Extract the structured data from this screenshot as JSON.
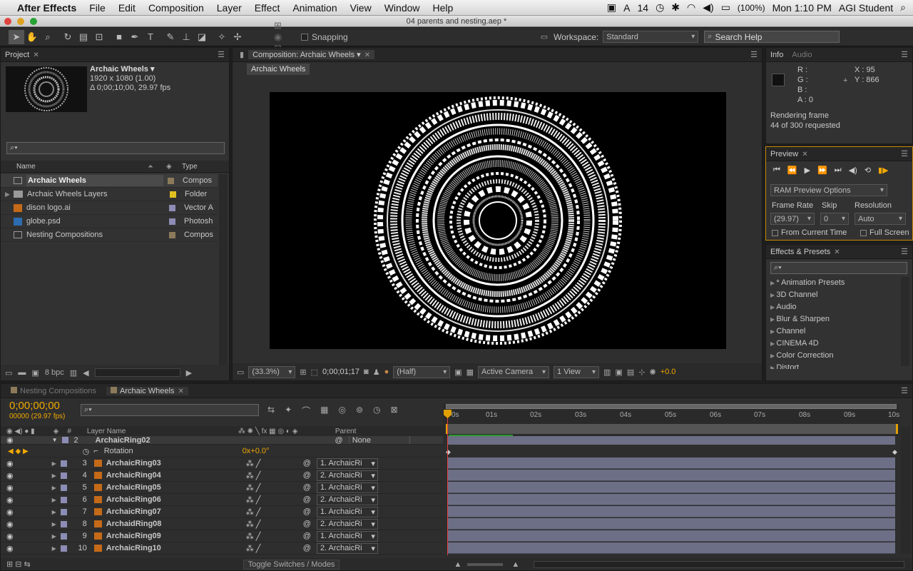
{
  "menubar": {
    "app": "After Effects",
    "items": [
      "File",
      "Edit",
      "Composition",
      "Layer",
      "Effect",
      "Animation",
      "View",
      "Window",
      "Help"
    ],
    "status_num": "14",
    "battery": "(100%)",
    "clock": "Mon 1:10 PM",
    "user": "AGI Student"
  },
  "window_title": "04 parents and nesting.aep *",
  "toolbar": {
    "snapping_label": "Snapping",
    "workspace_label": "Workspace:",
    "workspace_value": "Standard",
    "search_placeholder": "Search Help"
  },
  "project": {
    "tab": "Project",
    "selected_name": "Archaic Wheels ▾",
    "selected_size": "1920 x 1080 (1.00)",
    "selected_duration": "Δ 0;00;10;00, 29.97 fps",
    "col_name": "Name",
    "col_type": "Type",
    "items": [
      {
        "name": "Archaic Wheels",
        "type": "Compos",
        "color": "#8c7a5a",
        "icon": "composition-icon"
      },
      {
        "name": "Archaic Wheels Layers",
        "type": "Folder",
        "color": "#e0c020",
        "icon": "folder-icon"
      },
      {
        "name": "dison logo.ai",
        "type": "Vector A",
        "color": "#8c8cb4",
        "icon": "illustrator-file-icon"
      },
      {
        "name": "globe.psd",
        "type": "Photosh",
        "color": "#8c8cb4",
        "icon": "photoshop-file-icon"
      },
      {
        "name": "Nesting Compositions",
        "type": "Compos",
        "color": "#8c7a5a",
        "icon": "composition-icon"
      }
    ],
    "bpc": "8 bpc"
  },
  "composition": {
    "tab": "Composition: Archaic Wheels",
    "breadcrumb": "Archaic Wheels",
    "zoom": "(33.3%)",
    "timecode": "0;00;01;17",
    "resolution": "(Half)",
    "camera": "Active Camera",
    "view": "1 View",
    "exposure": "+0.0"
  },
  "info": {
    "tab": "Info",
    "tab2": "Audio",
    "r": "R :",
    "g": "G :",
    "b": "B :",
    "a": "A : 0",
    "x": "X : 95",
    "y": "Y : 866",
    "status1": "Rendering frame",
    "status2": "44 of 300 requested"
  },
  "preview": {
    "tab": "Preview",
    "ram_options": "RAM Preview Options",
    "frame_rate_label": "Frame Rate",
    "skip_label": "Skip",
    "resolution_label": "Resolution",
    "frame_rate": "(29.97)",
    "skip": "0",
    "resolution": "Auto",
    "from_current": "From Current Time",
    "full_screen": "Full Screen"
  },
  "effects": {
    "tab": "Effects & Presets",
    "items": [
      "* Animation Presets",
      "3D Channel",
      "Audio",
      "Blur & Sharpen",
      "Channel",
      "CINEMA 4D",
      "Color Correction",
      "Distort"
    ]
  },
  "timeline": {
    "tab1": "Nesting Compositions",
    "tab2": "Archaic Wheels",
    "timecode": "0;00;00;00",
    "frames": "00000 (29.97 fps)",
    "col_layer": "Layer Name",
    "col_parent": "Parent",
    "ruler": [
      "0s",
      "01s",
      "02s",
      "03s",
      "04s",
      "05s",
      "06s",
      "07s",
      "08s",
      "09s",
      "10s"
    ],
    "rotation_label": "Rotation",
    "rotation_value": "0x+0.0°",
    "layer2": {
      "num": "2",
      "name": "ArchaicRing02",
      "parent": "None"
    },
    "layers": [
      {
        "num": "3",
        "name": "ArchaicRing03",
        "parent": "1. ArchaicRi"
      },
      {
        "num": "4",
        "name": "ArchaicRing04",
        "parent": "2. ArchaicRi"
      },
      {
        "num": "5",
        "name": "ArchaicRing05",
        "parent": "1. ArchaicRi"
      },
      {
        "num": "6",
        "name": "ArchaicRing06",
        "parent": "2. ArchaicRi"
      },
      {
        "num": "7",
        "name": "ArchaicRing07",
        "parent": "1. ArchaicRi"
      },
      {
        "num": "8",
        "name": "ArchaidRing08",
        "parent": "2. ArchaicRi"
      },
      {
        "num": "9",
        "name": "ArchaicRing09",
        "parent": "1. ArchaicRi"
      },
      {
        "num": "10",
        "name": "ArchaicRing10",
        "parent": "2. ArchaicRi"
      }
    ],
    "toggle_label": "Toggle Switches / Modes"
  }
}
